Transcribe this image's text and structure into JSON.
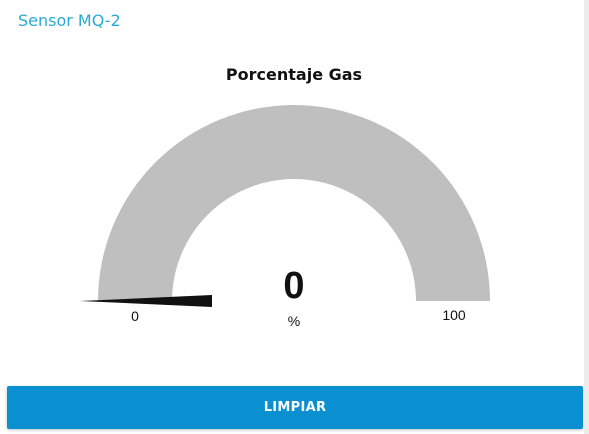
{
  "card": {
    "title": "Sensor MQ-2"
  },
  "gauge": {
    "title": "Porcentaje Gas",
    "value": 0,
    "value_text": "0",
    "unit": "%",
    "min": 0,
    "max": 100,
    "min_label": "0",
    "max_label": "100",
    "colors": {
      "track": "#bfbfbf",
      "pointer": "#111111",
      "title": "#111111",
      "card_title": "#2ba9d6"
    }
  },
  "actions": {
    "clear_label": "LIMPIAR",
    "button_color": "#0a8fd0"
  }
}
